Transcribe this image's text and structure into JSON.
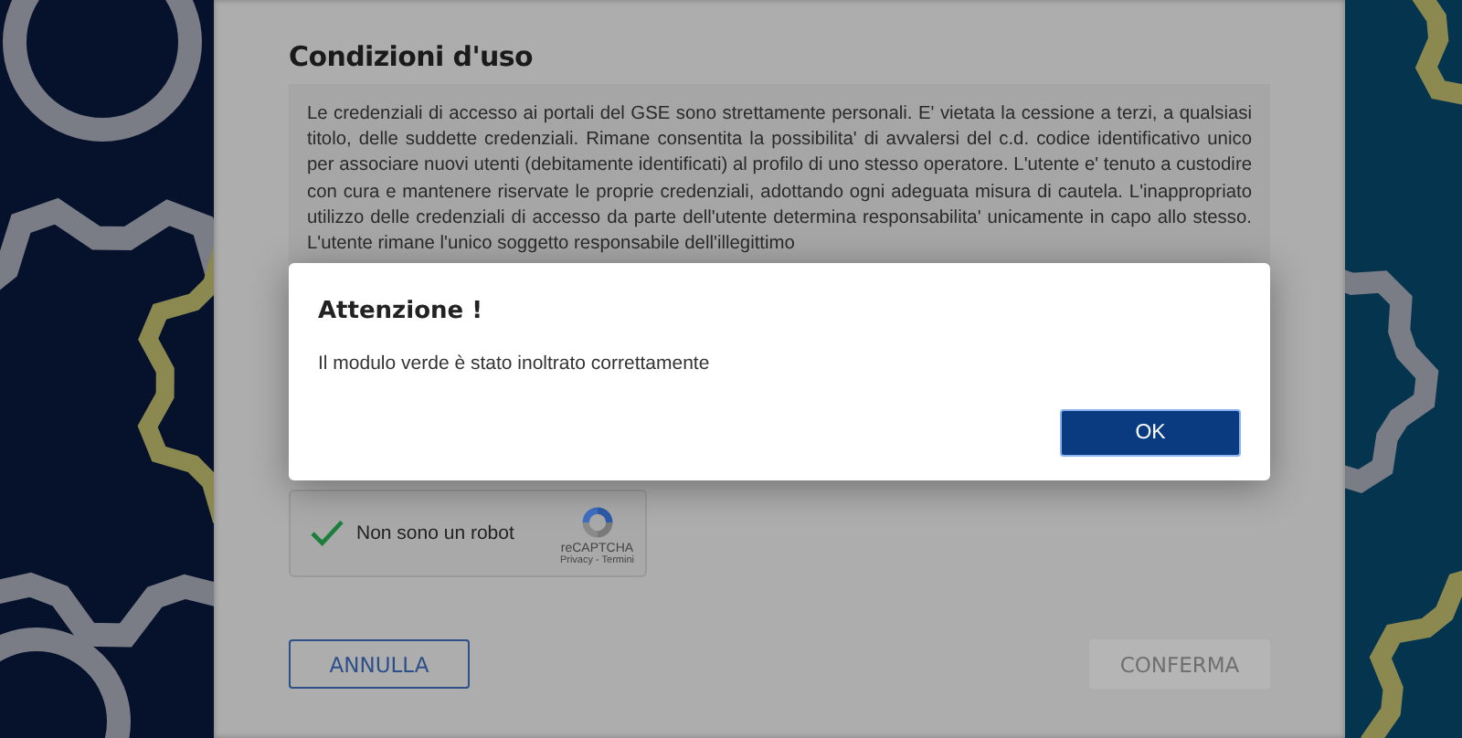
{
  "page": {
    "title": "Condizioni d'uso",
    "terms_text": "Le credenziali di accesso ai portali del GSE sono strettamente personali. E' vietata la cessione a terzi, a qualsiasi titolo, delle suddette credenziali. Rimane consentita la possibilita' di avvalersi del c.d. codice identificativo unico per associare nuovi utenti (debitamente identificati) al profilo di uno stesso operatore. L'utente e' tenuto a custodire con cura e mantenere riservate le proprie credenziali, adottando ogni adeguata misura di cautela. L'inappropriato utilizzo delle credenziali di accesso da parte dell'utente determina responsabilita' unicamente in capo allo stesso. L'utente rimane l'unico soggetto responsabile dell'illegittimo",
    "captcha": {
      "label": "Non sono un robot",
      "checked": true,
      "brand": "reCAPTCHA",
      "links": "Privacy - Termini"
    },
    "buttons": [
      {
        "label": "ANNULLA",
        "kind": "outline",
        "disabled": false
      },
      {
        "label": "CONFERMA",
        "kind": "primary",
        "disabled": true
      }
    ]
  },
  "dialog": {
    "title": "Attenzione !",
    "message": "Il modulo verde è stato inoltrato correttamente",
    "button": "OK"
  }
}
